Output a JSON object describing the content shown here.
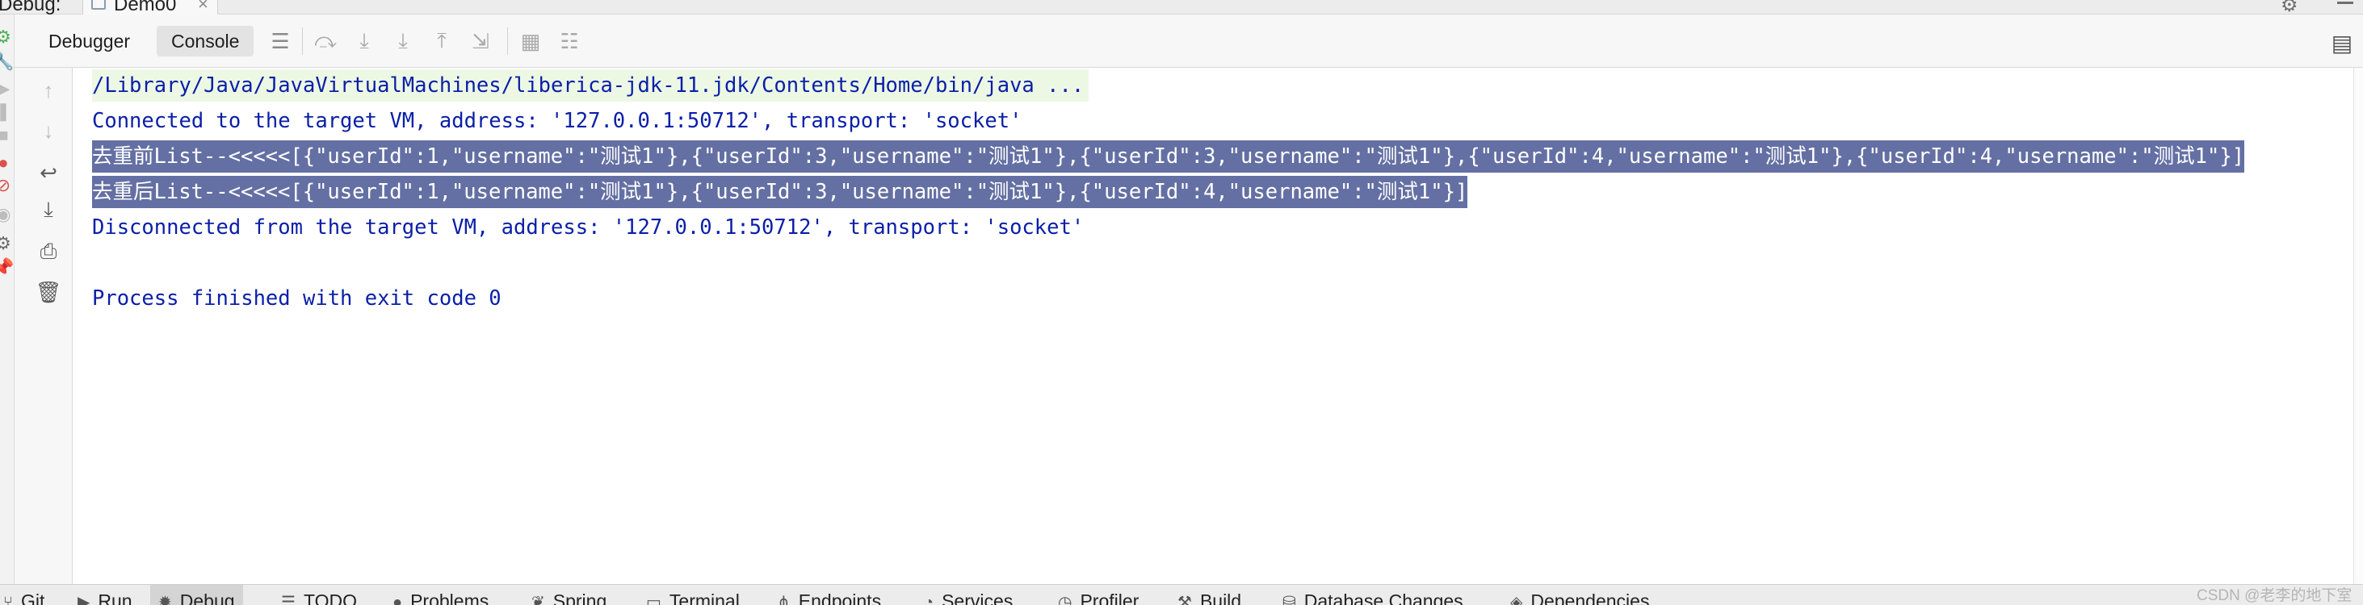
{
  "header": {
    "debug_label": "Debug:",
    "run_config": "Demo0",
    "close_glyph": "×"
  },
  "tabs": {
    "debugger": "Debugger",
    "console": "Console"
  },
  "console": {
    "lines": [
      "/Library/Java/JavaVirtualMachines/liberica-jdk-11.jdk/Contents/Home/bin/java ...",
      "Connected to the target VM, address: '127.0.0.1:50712', transport: 'socket'",
      "去重前List--<<<<<[{\"userId\":1,\"username\":\"测试1\"},{\"userId\":3,\"username\":\"测试1\"},{\"userId\":3,\"username\":\"测试1\"},{\"userId\":4,\"username\":\"测试1\"},{\"userId\":4,\"username\":\"测试1\"}]",
      "去重后List--<<<<<[{\"userId\":1,\"username\":\"测试1\"},{\"userId\":3,\"username\":\"测试1\"},{\"userId\":4,\"username\":\"测试1\"}]",
      "Disconnected from the target VM, address: '127.0.0.1:50712', transport: 'socket'",
      "Process finished with exit code 0"
    ]
  },
  "bottom_bar": {
    "items": [
      "Git",
      "Run",
      "Debug",
      "TODO",
      "Problems",
      "Spring",
      "Terminal",
      "Endpoints",
      "Services",
      "Profiler",
      "Build",
      "Database Changes",
      "Dependencies"
    ],
    "active": "Debug"
  },
  "watermark": "CSDN @老李的地下室",
  "colors": {
    "console_text": "#0a1fa8",
    "selection_bg": "#6470a3",
    "command_bg": "#edf8e4"
  },
  "icons": {
    "toolbar": [
      "show-execution-point-icon",
      "step-over-icon",
      "step-into-icon",
      "force-step-into-icon",
      "step-out-icon",
      "run-to-cursor-icon",
      "evaluate-expression-icon",
      "trace-icon"
    ],
    "console_tools": [
      "up-arrow-icon",
      "down-arrow-icon",
      "soft-wrap-icon",
      "scroll-to-end-icon",
      "print-icon",
      "clear-all-icon"
    ]
  }
}
